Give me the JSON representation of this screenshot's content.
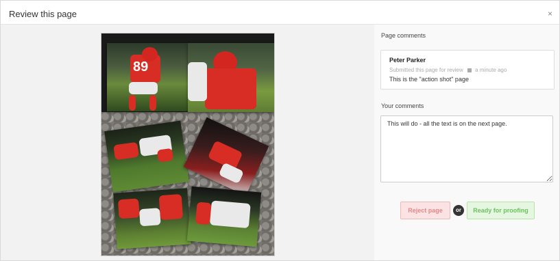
{
  "dialog": {
    "title": "Review this page",
    "close_glyph": "×"
  },
  "preview": {
    "jersey_number": "89"
  },
  "comments": {
    "section_label": "Page comments",
    "items": [
      {
        "author": "Peter Parker",
        "action": "Submitted this page for review",
        "time_icon": "calendar-icon",
        "time": "a minute ago",
        "text": "This is the \"action shot\" page"
      }
    ]
  },
  "your_comments": {
    "label": "Your comments",
    "value": "This will do - all the text is on the next page."
  },
  "actions": {
    "reject_label": "Reject page",
    "or_label": "or",
    "proof_label": "Ready for proofing",
    "colors": {
      "reject_bg": "#fbe3e3",
      "reject_text": "#e58888",
      "proof_bg": "#e5f7e0",
      "proof_text": "#6cc15f"
    }
  }
}
